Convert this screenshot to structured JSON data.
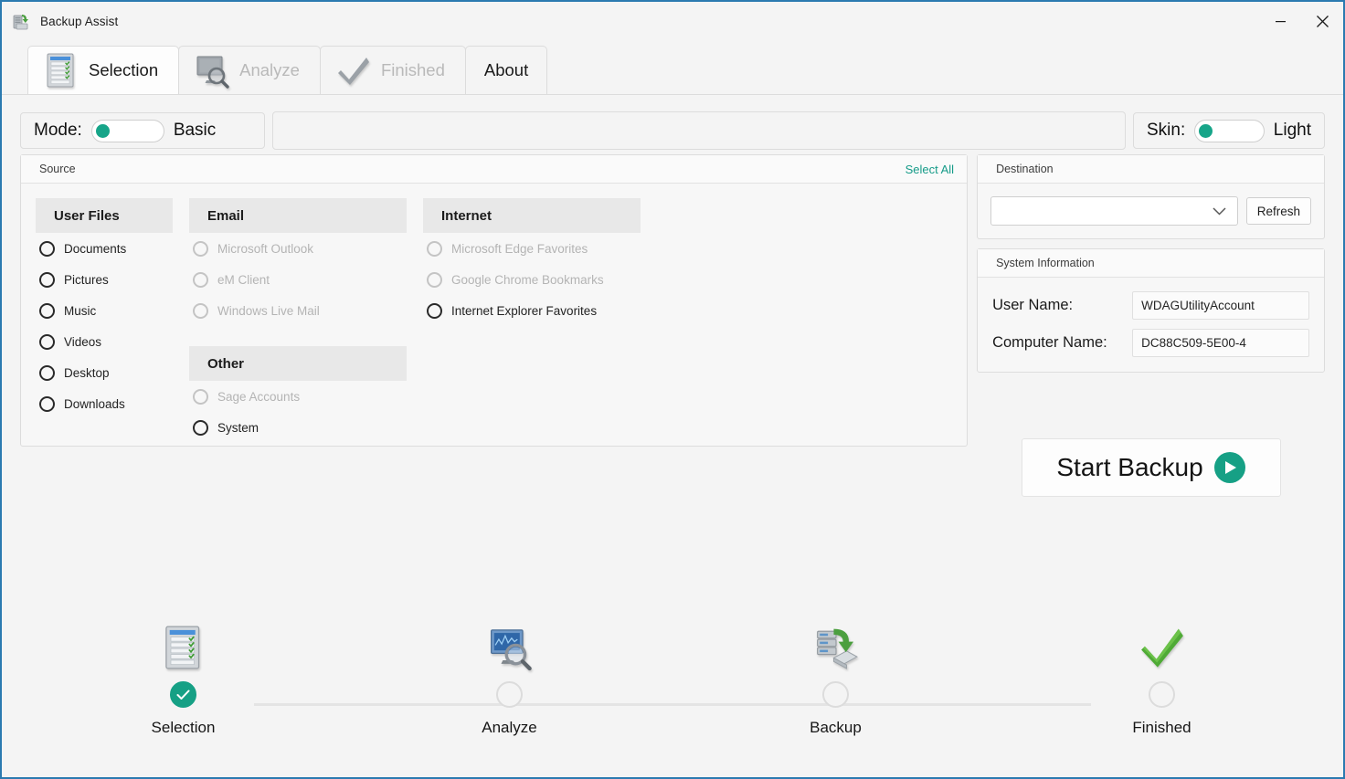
{
  "window": {
    "title": "Backup Assist",
    "icon": "backup-app-icon",
    "border_color": "#2b7ab0",
    "controls": [
      {
        "name": "minimize",
        "glyph": "minimize-icon"
      },
      {
        "name": "close",
        "glyph": "close-icon"
      }
    ]
  },
  "theme": {
    "accent": "#16a085",
    "link": "#159b88",
    "background": "#f4f4f4",
    "panel_bg": "#f7f7f7",
    "group_header_bg": "#e8e8e8",
    "border": "#dcdcdc",
    "disabled_text": "#b4b4b4"
  },
  "tabs": [
    {
      "label": "Selection",
      "icon": "checklist-icon",
      "active": true,
      "disabled": false
    },
    {
      "label": "Analyze",
      "icon": "monitor-magnifier-icon",
      "active": false,
      "disabled": true
    },
    {
      "label": "Finished",
      "icon": "checkmark-icon",
      "active": false,
      "disabled": true
    },
    {
      "label": "About",
      "icon": "",
      "active": false,
      "disabled": false
    }
  ],
  "toolbar": {
    "mode": {
      "label": "Mode:",
      "value": "Basic",
      "toggle_state": "left"
    },
    "skin": {
      "label": "Skin:",
      "value": "Light",
      "toggle_state": "left"
    }
  },
  "source": {
    "title": "Source",
    "select_all": "Select All",
    "columns": [
      {
        "name": "user-files",
        "groups": [
          {
            "header": "User Files",
            "items": [
              {
                "label": "Documents",
                "checked": false,
                "disabled": false
              },
              {
                "label": "Pictures",
                "checked": false,
                "disabled": false
              },
              {
                "label": "Music",
                "checked": false,
                "disabled": false
              },
              {
                "label": "Videos",
                "checked": false,
                "disabled": false
              },
              {
                "label": "Desktop",
                "checked": false,
                "disabled": false
              },
              {
                "label": "Downloads",
                "checked": false,
                "disabled": false
              }
            ]
          }
        ]
      },
      {
        "name": "email-and-other",
        "groups": [
          {
            "header": "Email",
            "items": [
              {
                "label": "Microsoft Outlook",
                "checked": false,
                "disabled": true
              },
              {
                "label": "eM Client",
                "checked": false,
                "disabled": true
              },
              {
                "label": "Windows Live Mail",
                "checked": false,
                "disabled": true
              }
            ]
          },
          {
            "header": "Other",
            "items": [
              {
                "label": "Sage Accounts",
                "checked": false,
                "disabled": true
              },
              {
                "label": "System",
                "checked": false,
                "disabled": false
              }
            ]
          }
        ]
      },
      {
        "name": "internet",
        "groups": [
          {
            "header": "Internet",
            "items": [
              {
                "label": "Microsoft Edge Favorites",
                "checked": false,
                "disabled": true
              },
              {
                "label": "Google Chrome Bookmarks",
                "checked": false,
                "disabled": true
              },
              {
                "label": "Internet Explorer Favorites",
                "checked": false,
                "disabled": false
              }
            ]
          }
        ]
      }
    ]
  },
  "destination": {
    "title": "Destination",
    "select_value": "",
    "select_placeholder": "",
    "refresh_label": "Refresh"
  },
  "system_information": {
    "title": "System Information",
    "rows": [
      {
        "label": "User Name:",
        "value": "WDAGUtilityAccount"
      },
      {
        "label": "Computer Name:",
        "value": "DC88C509-5E00-4"
      }
    ]
  },
  "start_backup": {
    "label": "Start Backup",
    "icon": "play-icon"
  },
  "stepper": {
    "steps": [
      {
        "label": "Selection",
        "icon": "checklist-icon",
        "state": "done"
      },
      {
        "label": "Analyze",
        "icon": "monitor-magnifier-icon",
        "state": "pending"
      },
      {
        "label": "Backup",
        "icon": "server-drive-icon",
        "state": "pending"
      },
      {
        "label": "Finished",
        "icon": "green-check-icon",
        "state": "pending"
      }
    ]
  }
}
